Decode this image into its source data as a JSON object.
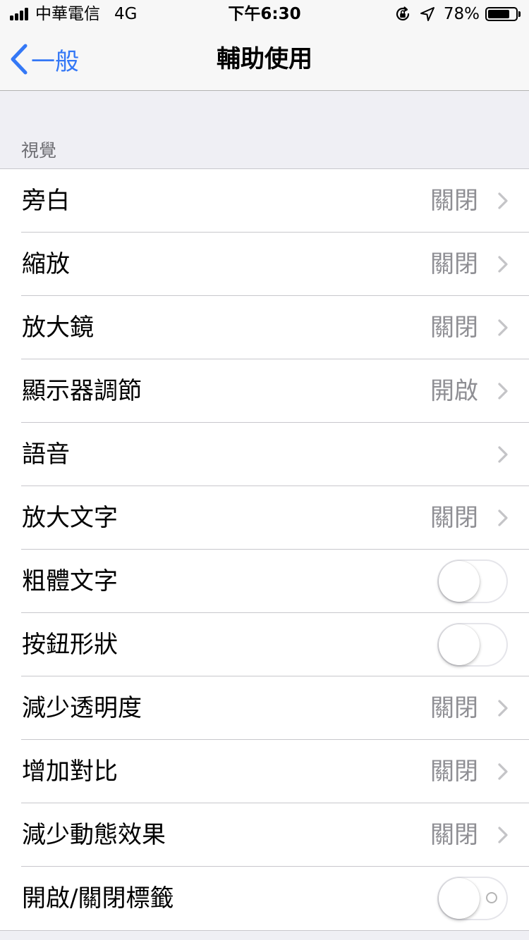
{
  "status_bar": {
    "carrier": "中華電信",
    "network": "4G",
    "time": "下午6:30",
    "battery_text": "78%",
    "battery_level": 0.78,
    "icons": [
      "signal-bars-icon",
      "rotation-lock-icon",
      "location-arrow-icon",
      "battery-icon"
    ]
  },
  "nav": {
    "back_label": "一般",
    "title": "輔助使用",
    "accent": "#3478f6"
  },
  "section": {
    "header": "視覺"
  },
  "rows": [
    {
      "label": "旁白",
      "value": "關閉",
      "type": "disclosure"
    },
    {
      "label": "縮放",
      "value": "關閉",
      "type": "disclosure"
    },
    {
      "label": "放大鏡",
      "value": "關閉",
      "type": "disclosure"
    },
    {
      "label": "顯示器調節",
      "value": "開啟",
      "type": "disclosure"
    },
    {
      "label": "語音",
      "value": "",
      "type": "disclosure"
    },
    {
      "label": "放大文字",
      "value": "關閉",
      "type": "disclosure"
    },
    {
      "label": "粗體文字",
      "type": "toggle",
      "on": false
    },
    {
      "label": "按鈕形狀",
      "type": "toggle",
      "on": false
    },
    {
      "label": "減少透明度",
      "value": "關閉",
      "type": "disclosure"
    },
    {
      "label": "增加對比",
      "value": "關閉",
      "type": "disclosure"
    },
    {
      "label": "減少動態效果",
      "value": "關閉",
      "type": "disclosure"
    },
    {
      "label": "開啟/關閉標籤",
      "type": "toggle",
      "on": false,
      "show_off_label": true
    }
  ]
}
